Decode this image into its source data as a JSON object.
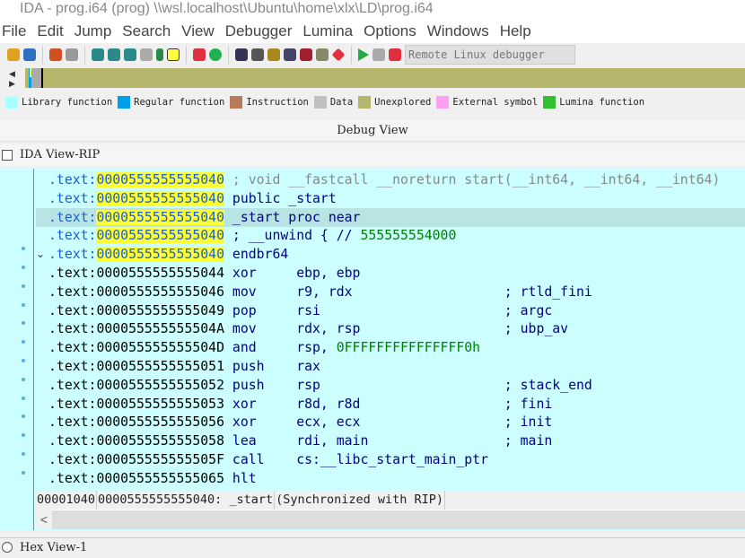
{
  "window": {
    "title": "IDA - prog.i64 (prog) \\\\wsl.localhost\\Ubuntu\\home\\xlx\\LD\\prog.i64"
  },
  "menu": [
    "File",
    "Edit",
    "Jump",
    "Search",
    "View",
    "Debugger",
    "Lumina",
    "Options",
    "Windows",
    "Help"
  ],
  "toolbar": {
    "debugger_select": "Remote Linux debugger",
    "run_color": "#22aa44",
    "stop_color": "#e03040"
  },
  "legend": [
    {
      "label": "Library function",
      "color": "#aaffff"
    },
    {
      "label": "Regular function",
      "color": "#00a0e8"
    },
    {
      "label": "Instruction",
      "color": "#b87a5a"
    },
    {
      "label": "Data",
      "color": "#c0c0c0"
    },
    {
      "label": "Unexplored",
      "color": "#b5b56c"
    },
    {
      "label": "External symbol",
      "color": "#ffa0f0"
    },
    {
      "label": "Lumina function",
      "color": "#30c030"
    }
  ],
  "debug_view": {
    "title": "Debug View"
  },
  "ida_view": {
    "tab": "IDA View-RIP",
    "rows": [
      {
        "seg": ".text:",
        "addr": "0000555555555040",
        "code": "; void __fastcall __noreturn start(__int64, __int64, __int64)",
        "kind": "comment"
      },
      {
        "seg": ".text:",
        "addr": "0000555555555040",
        "code": "public _start"
      },
      {
        "seg": ".text:",
        "addr": "0000555555555040",
        "code": "_start proc near"
      },
      {
        "seg": ".text:",
        "addr": "0000555555555040",
        "code": "; __unwind { // ",
        "num": "555555554000"
      },
      {
        "seg": ".text:",
        "addr": "0000555555555040",
        "code": "endbr64"
      },
      {
        "seg": ".text:",
        "addr": "0000555555555044",
        "code": "xor     ebp, ebp"
      },
      {
        "seg": ".text:",
        "addr": "0000555555555046",
        "code": "mov     r9, rdx                   ; rtld_fini"
      },
      {
        "seg": ".text:",
        "addr": "0000555555555049",
        "code": "pop     rsi                       ; argc"
      },
      {
        "seg": ".text:",
        "addr": "000055555555504A",
        "code": "mov     rdx, rsp                  ; ubp_av"
      },
      {
        "seg": ".text:",
        "addr": "000055555555504D",
        "code": "and     rsp, ",
        "num": "0FFFFFFFFFFFFFFF0h"
      },
      {
        "seg": ".text:",
        "addr": "0000555555555051",
        "code": "push    rax"
      },
      {
        "seg": ".text:",
        "addr": "0000555555555052",
        "code": "push    rsp                       ; stack_end"
      },
      {
        "seg": ".text:",
        "addr": "0000555555555053",
        "code": "xor     r8d, r8d                  ; fini"
      },
      {
        "seg": ".text:",
        "addr": "0000555555555056",
        "code": "xor     ecx, ecx                  ; init"
      },
      {
        "seg": ".text:",
        "addr": "0000555555555058",
        "code": "lea     rdi, main                 ; main"
      },
      {
        "seg": ".text:",
        "addr": "000055555555505F",
        "code": "call    cs:__libc_start_main_ptr"
      },
      {
        "seg": ".text:",
        "addr": "0000555555555065",
        "code": "hlt"
      }
    ],
    "status": {
      "offset": "00001040",
      "location": "0000555555555040: _start",
      "sync": "(Synchronized with RIP)"
    }
  },
  "hex_view": {
    "tab": "Hex View-1"
  }
}
